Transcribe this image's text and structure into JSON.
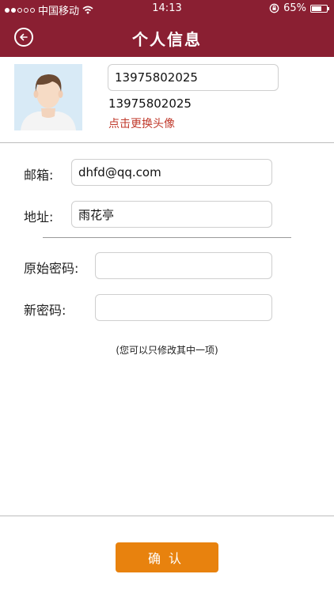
{
  "status_bar": {
    "carrier": "中国移动",
    "time": "14:13",
    "battery": "65%",
    "battery_level": 0.65
  },
  "nav": {
    "title": "个人信息"
  },
  "profile": {
    "phone_value": "13975802025",
    "phone_display": "13975802025",
    "change_avatar": "点击更换头像"
  },
  "form": {
    "email_label": "邮箱:",
    "email_value": "dhfd@qq.com",
    "address_label": "地址:",
    "address_value": "雨花亭",
    "old_password_label": "原始密码:",
    "old_password_value": "",
    "new_password_label": "新密码:",
    "new_password_value": "",
    "hint": "(您可以只修改其中一项)"
  },
  "footer": {
    "confirm_label": "确认"
  },
  "colors": {
    "header": "#8a1f32",
    "accent_button": "#e8820e",
    "link_red": "#c0392b"
  }
}
